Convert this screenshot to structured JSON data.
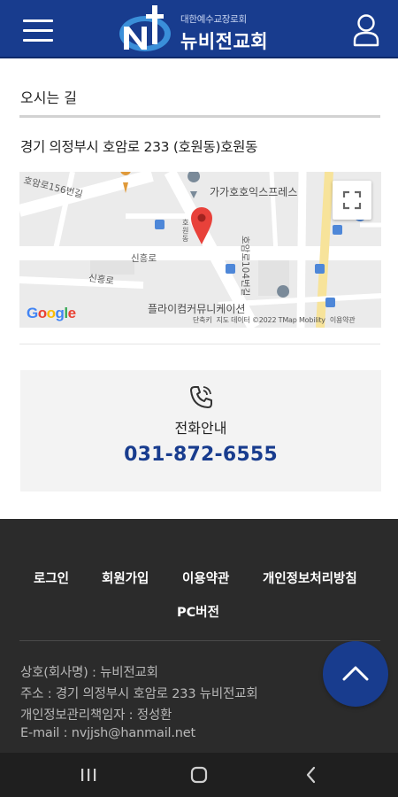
{
  "header": {
    "logo_subtitle": "대한예수교장로회",
    "logo_title": "뉴비전교회",
    "menu_icon": "hamburger-menu-icon",
    "user_icon": "user-icon",
    "brand_color": "#183c8e"
  },
  "directions": {
    "title": "오시는 길",
    "address": "경기 의정부시 호암로 233 (호원동)호원동"
  },
  "map": {
    "road_labels": [
      "신흥로",
      "신흥로",
      "호암로156번길",
      "호암로104번길"
    ],
    "poi_name": "가가호호익스프레스",
    "poi_bottom": "플라이컴커뮤니케이션",
    "marker_label": "호원동",
    "fullscreen_icon": "fullscreen-icon",
    "google_text": "Google",
    "footer_links": [
      "단축키",
      "지도 데이터 ©2022 TMap Mobility",
      "이용약관"
    ]
  },
  "phone": {
    "icon": "phone-icon",
    "label": "전화안내",
    "number": "031-872-6555"
  },
  "footer": {
    "links": [
      "로그인",
      "회원가입",
      "이용약관",
      "개인정보처리방침",
      "PC버전"
    ],
    "info": [
      "상호(회사명) : 뉴비전교회",
      "주소 : 경기 의정부시 호암로 233 뉴비전교회",
      "개인정보관리책임자 : 정성환",
      "E-mail : nvjjsh@hanmail.net"
    ]
  },
  "scroll_top_icon": "chevron-up-icon",
  "navbar": {
    "icons": [
      "recent-apps-icon",
      "home-icon",
      "back-icon"
    ]
  }
}
